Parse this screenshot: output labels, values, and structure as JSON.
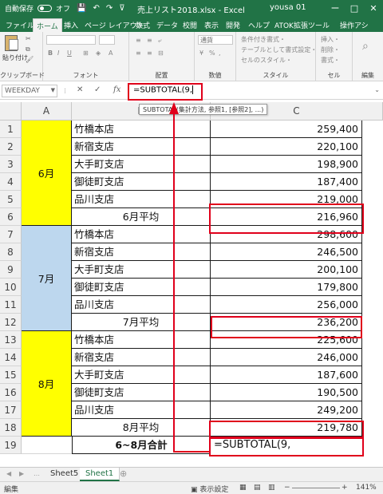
{
  "titlebar": {
    "autosave": "自動保存",
    "toggle": "オフ",
    "title": "売上リスト2018.xlsx  -  Excel",
    "user": "yousa 01",
    "controls": [
      "ー",
      "□",
      "✕"
    ]
  },
  "tabs": [
    "ファイル",
    "ホーム",
    "挿入",
    "ページ レイアウト",
    "数式",
    "データ",
    "校閲",
    "表示",
    "開発",
    "ヘルプ",
    "ATOK拡張ツール",
    "操作アシ"
  ],
  "ribbon": {
    "groups": [
      "クリップボード",
      "フォント",
      "配置",
      "数値",
      "スタイル",
      "セル",
      "編集"
    ],
    "paste": "貼り付け",
    "number_format": "通貨",
    "style_items": [
      "条件付き書式・",
      "テーブルとして書式設定・",
      "セルのスタイル・"
    ],
    "cell_items": [
      "挿入・",
      "削除・",
      "書式・"
    ]
  },
  "formula_bar": {
    "name_box": "WEEKDAY",
    "formula": "=SUBTOTAL(9,",
    "tooltip": "SUBTOTAL(集計方法, 参照1, [参照2], ...)"
  },
  "columns": [
    "A",
    "B",
    "C"
  ],
  "rows": [
    {
      "num": "1",
      "b": "竹橋本店",
      "c": "259,400"
    },
    {
      "num": "2",
      "b": "新宿支店",
      "c": "220,100"
    },
    {
      "num": "3",
      "b": "大手町支店",
      "c": "198,900"
    },
    {
      "num": "4",
      "b": "御徒町支店",
      "c": "187,400"
    },
    {
      "num": "5",
      "b": "品川支店",
      "c": "219,000"
    },
    {
      "num": "6",
      "b": "6月平均",
      "c": "216,960"
    },
    {
      "num": "7",
      "b": "竹橋本店",
      "c": "298,600"
    },
    {
      "num": "8",
      "b": "新宿支店",
      "c": "246,500"
    },
    {
      "num": "9",
      "b": "大手町支店",
      "c": "200,100"
    },
    {
      "num": "10",
      "b": "御徒町支店",
      "c": "179,800"
    },
    {
      "num": "11",
      "b": "品川支店",
      "c": "256,000"
    },
    {
      "num": "12",
      "b": "7月平均",
      "c": "236,200"
    },
    {
      "num": "13",
      "b": "竹橋本店",
      "c": "225,600"
    },
    {
      "num": "14",
      "b": "新宿支店",
      "c": "246,000"
    },
    {
      "num": "15",
      "b": "大手町支店",
      "c": "187,600"
    },
    {
      "num": "16",
      "b": "御徒町支店",
      "c": "190,500"
    },
    {
      "num": "17",
      "b": "品川支店",
      "c": "249,200"
    },
    {
      "num": "18",
      "b": "8月平均",
      "c": "219,780"
    },
    {
      "num": "19",
      "b": "6~8月合計",
      "c": "=SUBTOTAL(9,"
    }
  ],
  "months": [
    "6月",
    "7月",
    "8月"
  ],
  "colors": {
    "june": "#ffff00",
    "july": "#bdd7ee",
    "august": "#ffff00",
    "highlight": "#e0001b",
    "excel_green": "#217346"
  },
  "sheets": [
    "Sheet5",
    "Sheet1"
  ],
  "status": {
    "mode": "編集",
    "display_settings": "表示設定",
    "zoom": "141%"
  }
}
